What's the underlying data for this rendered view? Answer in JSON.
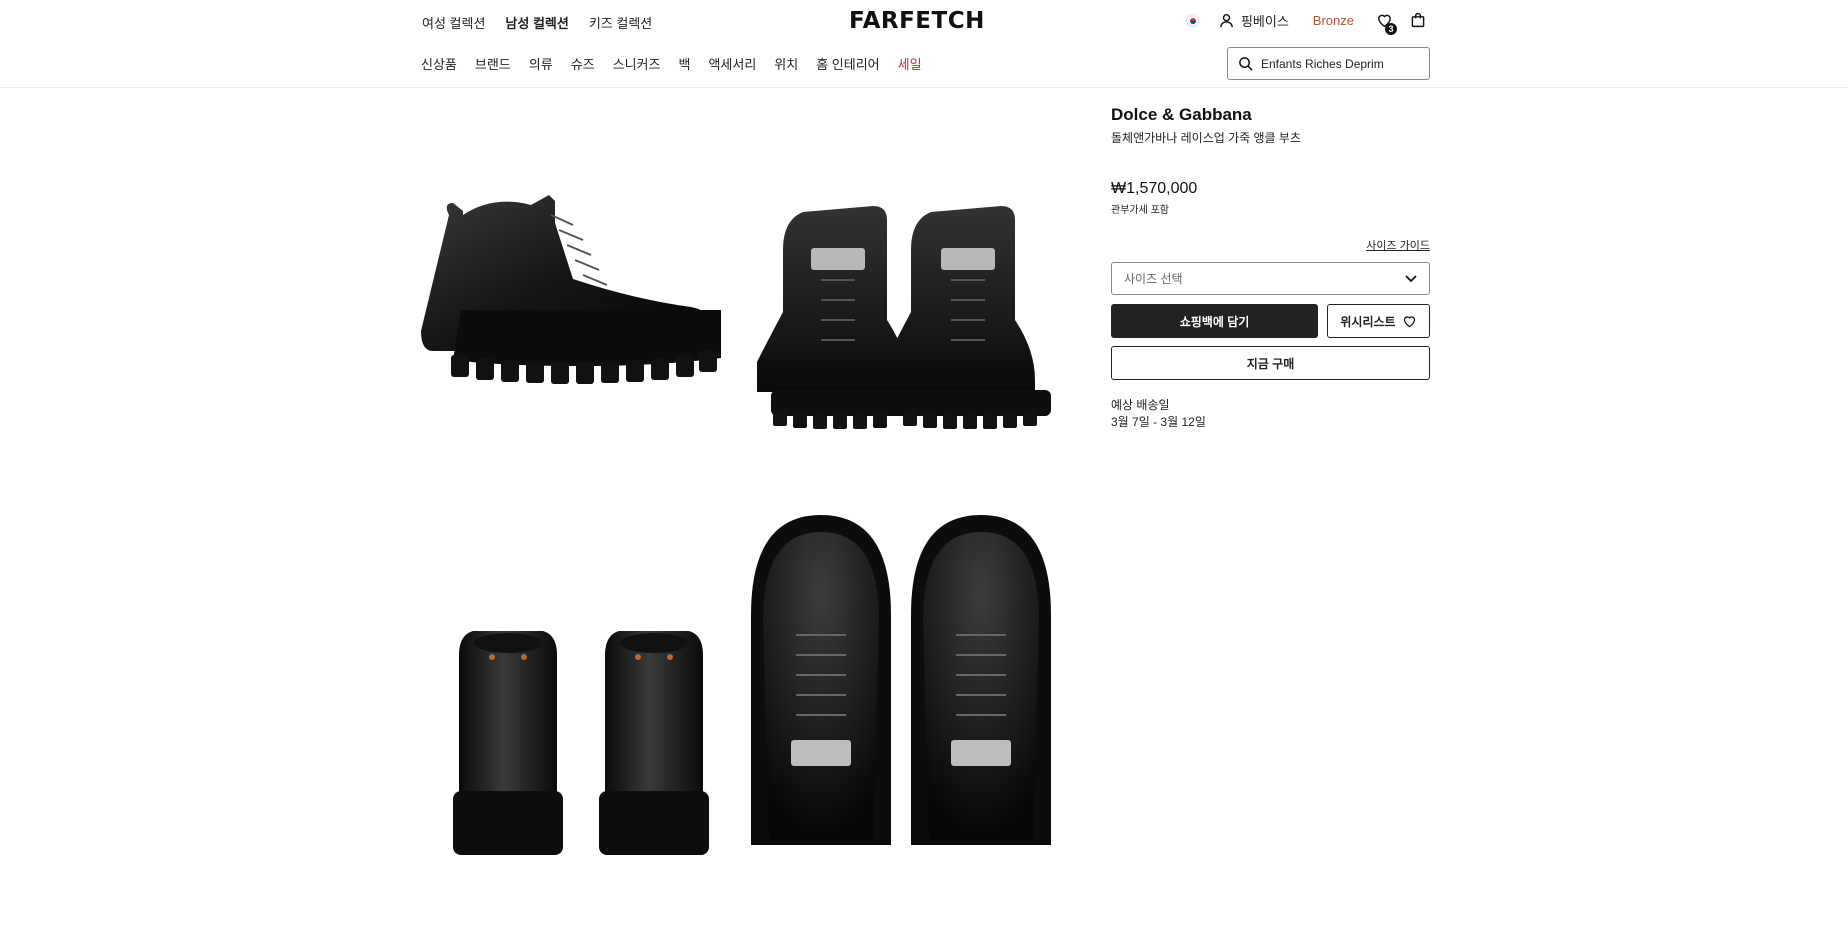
{
  "header": {
    "gender_tabs": [
      "여성 컬렉션",
      "남성 컬렉션",
      "키즈 컬렉션"
    ],
    "active_gender": "남성 컬렉션",
    "logo": "FARFETCH",
    "account_name": "핑베이스",
    "tier": "Bronze",
    "wishlist_count": "3",
    "categories": [
      "신상품",
      "브랜드",
      "의류",
      "슈즈",
      "스니커즈",
      "백",
      "액세서리",
      "위치",
      "홈 인테리어",
      "세일"
    ],
    "search_value": "Enfants Riches Deprim"
  },
  "product": {
    "brand": "Dolce & Gabbana",
    "description": "돌체앤가바나 레이스업 가죽 앵클 부츠",
    "price": "₩1,570,000",
    "tax_note": "관부가세 포함",
    "size_guide": "사이즈 가이드",
    "size_placeholder": "사이즈 선택",
    "add_to_bag": "쇼핑백에 담기",
    "wishlist": "위시리스트",
    "buy_now": "지금 구매",
    "delivery_label": "예상 배송일",
    "delivery_dates": "3월 7일 - 3월 12일"
  },
  "colors": {
    "sale": "#c32a2a",
    "tier": "#b8542d",
    "primary_button": "#222222"
  }
}
